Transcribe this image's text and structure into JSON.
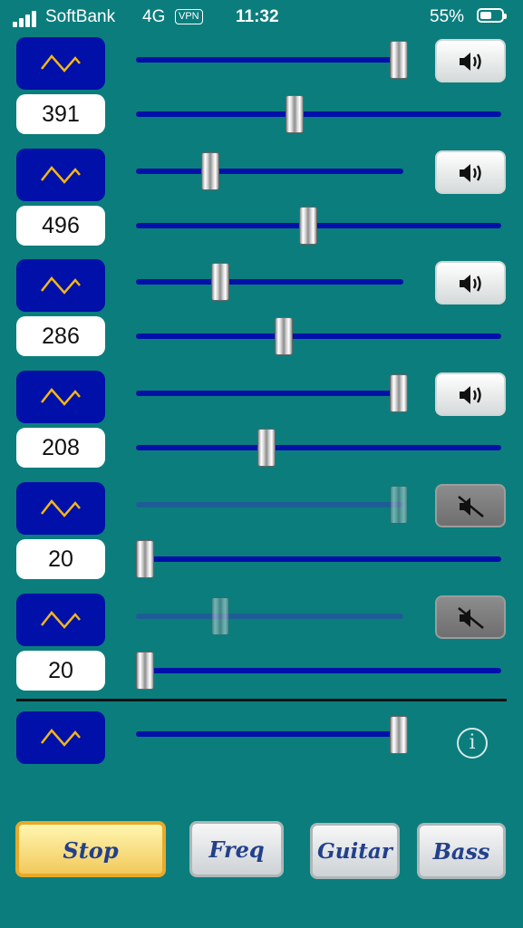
{
  "status_bar": {
    "carrier": "SoftBank",
    "network": "4G",
    "vpn": "VPN",
    "time": "11:32",
    "battery_percent": "55%",
    "battery_level": 0.55
  },
  "channels": [
    {
      "waveform": "triangle-wave-icon",
      "frequency": "391",
      "volume": 1.0,
      "frequency_slider": 0.43,
      "muted": false
    },
    {
      "waveform": "triangle-wave-icon",
      "frequency": "496",
      "volume": 0.27,
      "frequency_slider": 0.47,
      "muted": false
    },
    {
      "waveform": "triangle-wave-icon",
      "frequency": "286",
      "volume": 0.31,
      "frequency_slider": 0.4,
      "muted": false
    },
    {
      "waveform": "triangle-wave-icon",
      "frequency": "208",
      "volume": 1.0,
      "frequency_slider": 0.35,
      "muted": false
    },
    {
      "waveform": "triangle-wave-icon",
      "frequency": "20",
      "volume": 1.0,
      "frequency_slider": 0.0,
      "muted": true
    },
    {
      "waveform": "triangle-wave-icon",
      "frequency": "20",
      "volume": 0.31,
      "frequency_slider": 0.0,
      "muted": true
    }
  ],
  "master": {
    "waveform": "triangle-wave-icon",
    "volume": 1.0
  },
  "icons": {
    "speaker": "speaker-icon",
    "muted": "speaker-muted-icon",
    "info": "info-icon"
  },
  "buttons": {
    "stop": "Stop",
    "freq": "Freq",
    "guitar": "Guitar",
    "bass": "Bass"
  },
  "info_glyph": "i",
  "colors": {
    "background": "#0b7d7d",
    "accent_blue": "#0010a8",
    "wave_stroke": "#f2b618",
    "stop_gold": "#f2c95c"
  }
}
